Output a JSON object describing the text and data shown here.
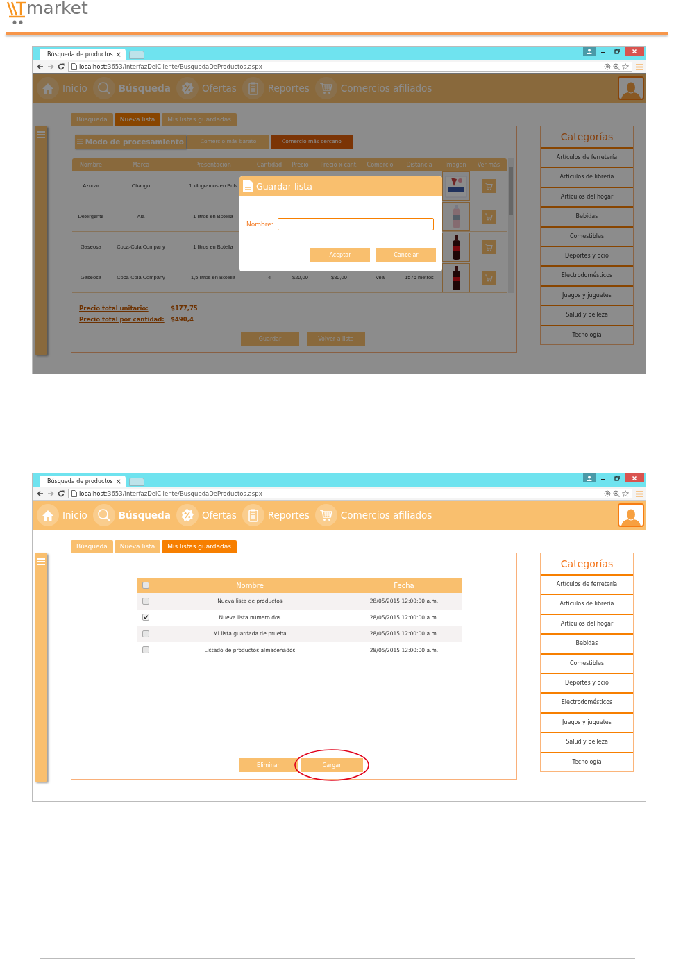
{
  "document": {
    "logo_text": "market"
  },
  "screenshots": [
    {
      "dimmed": true,
      "browser": {
        "tab_title": "Búsqueda de productos",
        "close_glyph": "×",
        "url_host": "localhost",
        "url_path": ":3653/InterfazDelCliente/BusquedaDeProductos.aspx"
      },
      "nav": [
        {
          "label": "Inicio",
          "selected": false
        },
        {
          "label": "Búsqueda",
          "selected": true
        },
        {
          "label": "Ofertas",
          "selected": false
        },
        {
          "label": "Reportes",
          "selected": false
        },
        {
          "label": "Comercios afiliados",
          "selected": false
        }
      ],
      "tabs": [
        {
          "label": "Búsqueda",
          "selected": false
        },
        {
          "label": "Nueva lista",
          "selected": true
        },
        {
          "label": "Mis listas guardadas",
          "selected": false
        }
      ],
      "content": {
        "kind": "products",
        "mode_title": "Modo de procesamiento",
        "modes": [
          {
            "label": "Comercio más barato",
            "selected": false
          },
          {
            "label": "Comercio más cercano",
            "selected": true
          }
        ],
        "columns": [
          "Nombre",
          "Marca",
          "Presentacion",
          "Cantidad",
          "Precio",
          "Precio x cant.",
          "Comercio",
          "Distancia",
          "Imagen",
          "Ver más"
        ],
        "rows": [
          {
            "cells": [
              "Azucar",
              "Chango",
              "1 kilogramos en Bols"
            ],
            "image": {
              "kind": "picture"
            }
          },
          {
            "cells": [
              "Detergente",
              "Ala",
              "1 litros en Botella"
            ],
            "image": {
              "kind": "picture"
            }
          },
          {
            "cells": [
              "Gaseosa",
              "Coca-Cola Company",
              "1 litros en Botella"
            ],
            "image": {
              "kind": "picture"
            }
          },
          {
            "cells": [
              "Gaseosa",
              "Coca-Cola Company",
              "1,5 litros en Botella",
              "4",
              "$20,00",
              "$80,00",
              "Vea",
              "1576 metros"
            ],
            "image": {
              "kind": "picture"
            }
          }
        ],
        "totals": [
          {
            "label": "Precio total unitario:",
            "value": "$177,75"
          },
          {
            "label": "Precio total por cantidad:",
            "value": "$490,4"
          }
        ],
        "buttons": [
          {
            "label": "Guardar",
            "highlighted": false
          },
          {
            "label": "Volver a lista",
            "highlighted": false
          }
        ]
      },
      "categories": {
        "title": "Categorías",
        "items": [
          "Artículos de ferretería",
          "Artículos de librería",
          "Artículos del hogar",
          "Bebidas",
          "Comestibles",
          "Deportes y ocio",
          "Electrodomésticos",
          "Juegos y juguetes",
          "Salud y belleza",
          "Tecnología"
        ]
      },
      "dialog": {
        "title": "Guardar lista",
        "field_label": "Nombre:",
        "buttons": [
          "Aceptar",
          "Cancelar"
        ]
      }
    },
    {
      "browser": {
        "tab_title": "Búsqueda de productos",
        "close_glyph": "×",
        "url_host": "localhost",
        "url_path": ":3653/InterfazDelCliente/BusquedaDeProductos.aspx"
      },
      "nav": [
        {
          "label": "Inicio",
          "selected": false
        },
        {
          "label": "Búsqueda",
          "selected": true
        },
        {
          "label": "Ofertas",
          "selected": false
        },
        {
          "label": "Reportes",
          "selected": false
        },
        {
          "label": "Comercios afiliados",
          "selected": false
        }
      ],
      "tabs": [
        {
          "label": "Búsqueda",
          "selected": false
        },
        {
          "label": "Nueva lista",
          "selected": false
        },
        {
          "label": "Mis listas guardadas",
          "selected": true
        }
      ],
      "content": {
        "kind": "saved_lists",
        "select_all_checked": false,
        "columns": [
          "Nombre",
          "Fecha"
        ],
        "rows": [
          {
            "name": "Nueva lista de productos",
            "date": "28/05/2015 12:00:00 a.m.",
            "checked": false
          },
          {
            "name": "Nueva lista número dos",
            "date": "28/05/2015 12:00:00 a.m.",
            "checked": true
          },
          {
            "name": "Mi lista guardada de prueba",
            "date": "28/05/2015 12:00:00 a.m.",
            "checked": false
          },
          {
            "name": "Listado de productos almacenados",
            "date": "28/05/2015 12:00:00 a.m.",
            "checked": false
          }
        ],
        "buttons": [
          {
            "label": "Eliminar",
            "highlighted": false
          },
          {
            "label": "Cargar",
            "highlighted": true
          }
        ]
      },
      "categories": {
        "title": "Categorías",
        "items": [
          "Artículos de ferretería",
          "Artículos de librería",
          "Artículos del hogar",
          "Bebidas",
          "Comestibles",
          "Deportes y ocio",
          "Electrodomésticos",
          "Juegos y juguetes",
          "Salud y belleza",
          "Tecnología"
        ]
      }
    }
  ]
}
